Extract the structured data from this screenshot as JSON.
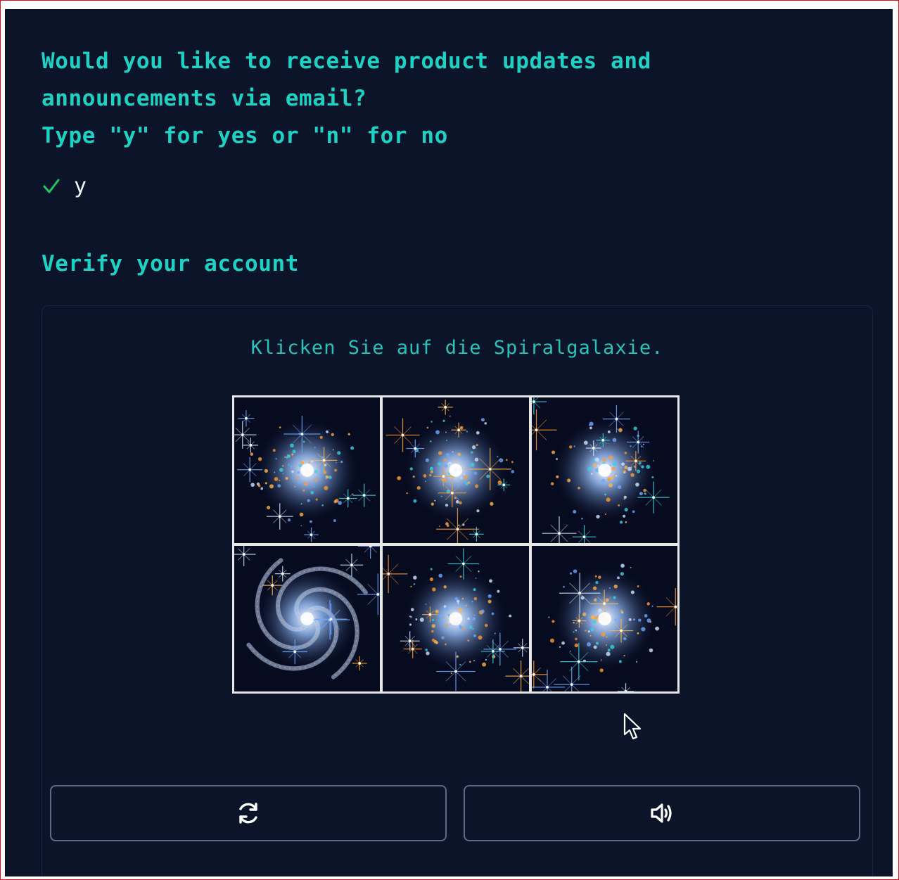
{
  "prompt": {
    "question_lines": [
      "Would you like to receive product updates and",
      "announcements via email?",
      "Type \"y\" for yes or \"n\" for no"
    ],
    "answer": "y",
    "answer_icon": "checkmark-icon",
    "accent_color": "#1ed2c3",
    "check_color": "#22c55e"
  },
  "verify": {
    "title": "Verify your account"
  },
  "captcha": {
    "instruction": "Klicken Sie auf die Spiralgalaxie.",
    "tiles": [
      {
        "content": "irregular-galaxy"
      },
      {
        "content": "irregular-galaxy"
      },
      {
        "content": "irregular-galaxy"
      },
      {
        "content": "spiral-galaxy"
      },
      {
        "content": "irregular-galaxy"
      },
      {
        "content": "irregular-galaxy"
      }
    ],
    "buttons": {
      "refresh_icon": "refresh-icon",
      "audio_icon": "speaker-icon"
    }
  },
  "colors": {
    "background": "#0b1429",
    "frame_border": "#d9141e",
    "button_border": "#5d6b86"
  }
}
